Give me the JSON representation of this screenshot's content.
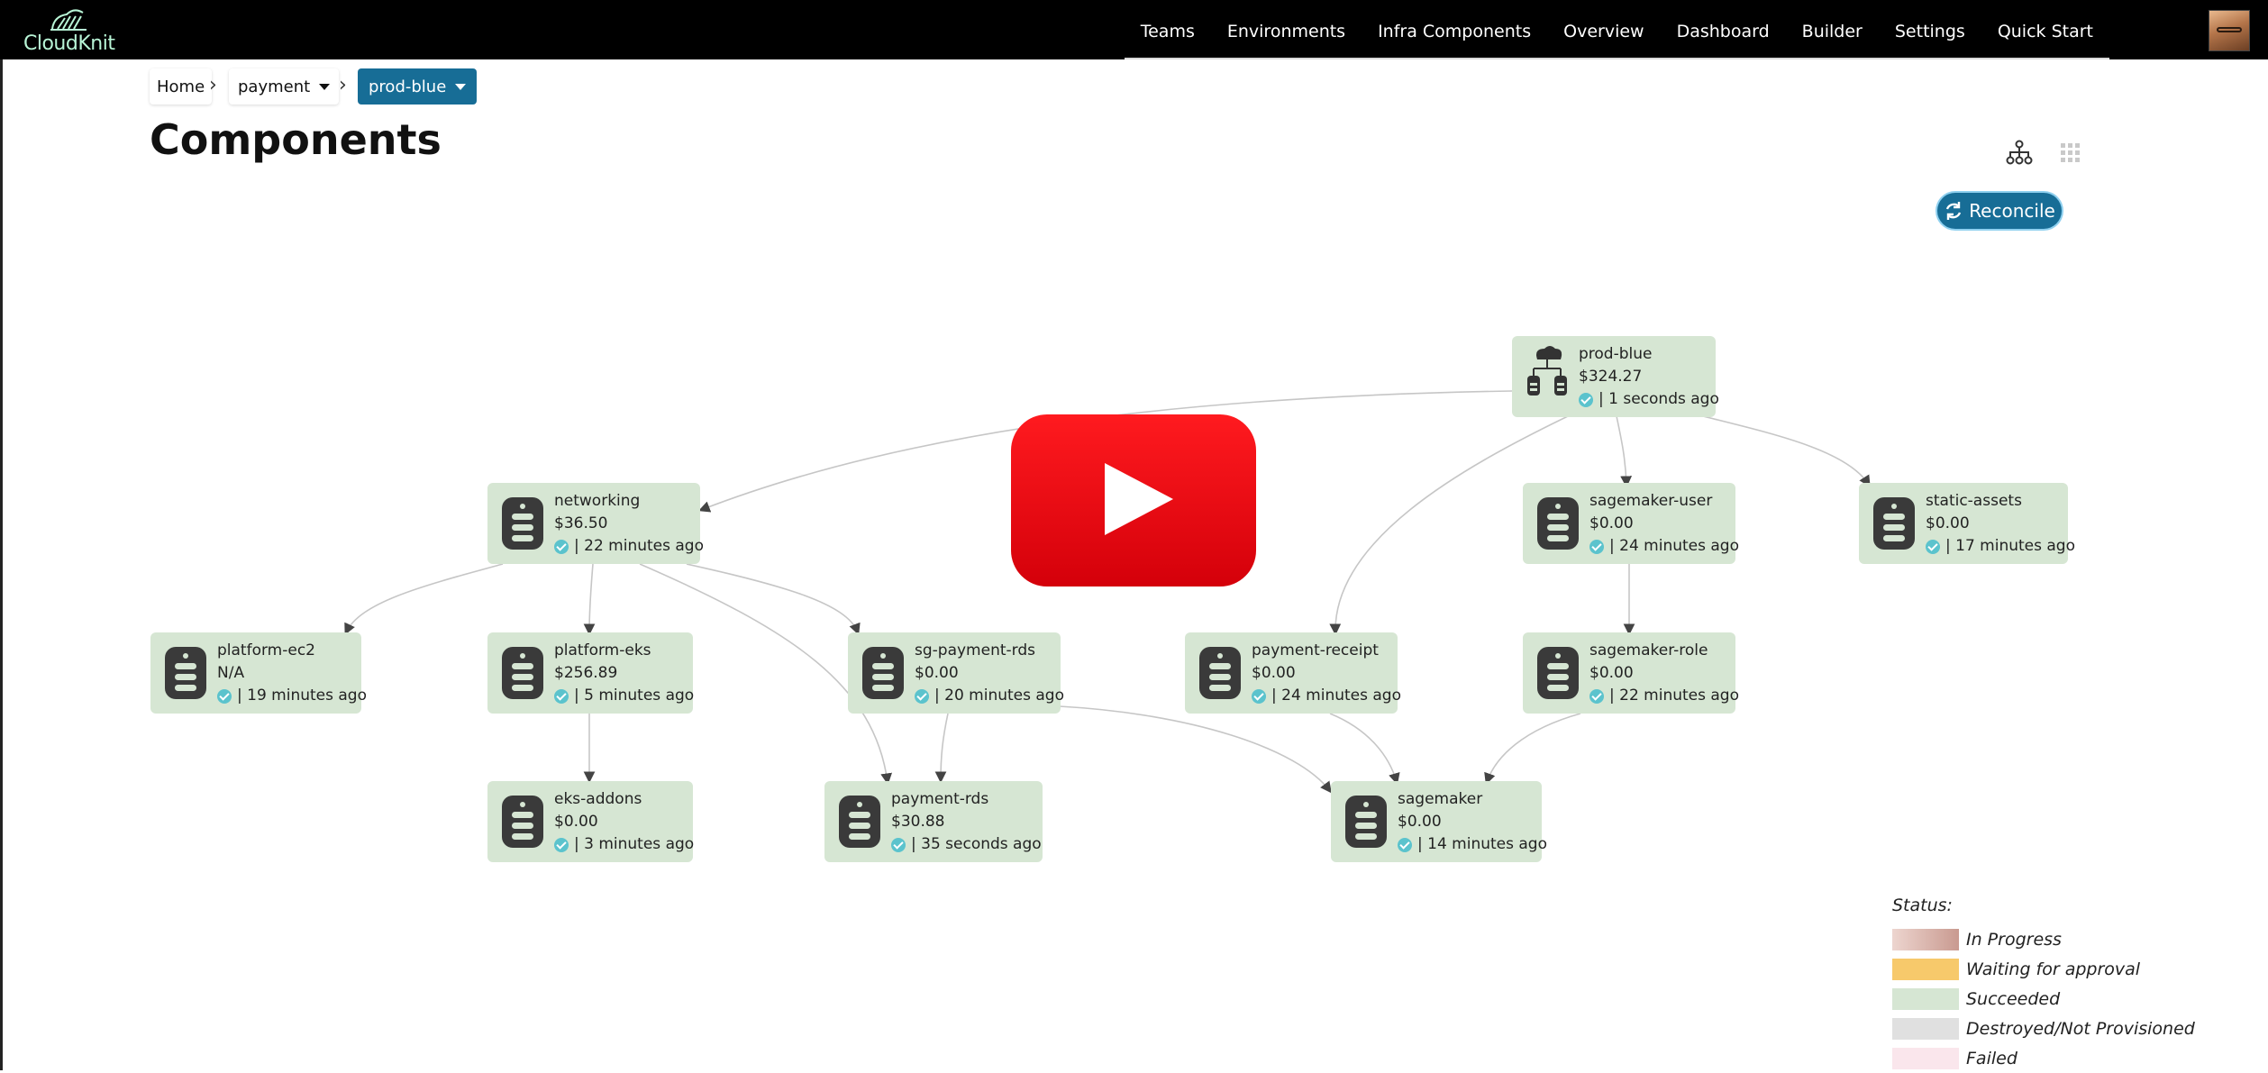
{
  "app": {
    "logo_text": "CloudKnit"
  },
  "nav": {
    "items": [
      "Teams",
      "Environments",
      "Infra Components",
      "Overview",
      "Dashboard",
      "Builder",
      "Settings",
      "Quick Start"
    ]
  },
  "breadcrumb": {
    "home": "Home",
    "team": "payment",
    "environment": "prod-blue"
  },
  "page": {
    "title": "Components",
    "reconcile_label": "Reconcile"
  },
  "nodes": [
    {
      "id": "prod-blue",
      "name": "prod-blue",
      "cost": "$324.27",
      "status": "| 1 seconds ago",
      "icon": "cloud-network-icon"
    },
    {
      "id": "networking",
      "name": "networking",
      "cost": "$36.50",
      "status": "| 22 minutes ago",
      "icon": "server-icon"
    },
    {
      "id": "sagemaker-user",
      "name": "sagemaker-user",
      "cost": "$0.00",
      "status": "| 24 minutes ago",
      "icon": "server-icon"
    },
    {
      "id": "static-assets",
      "name": "static-assets",
      "cost": "$0.00",
      "status": "| 17 minutes ago",
      "icon": "server-icon"
    },
    {
      "id": "platform-ec2",
      "name": "platform-ec2",
      "cost": "N/A",
      "status": "| 19 minutes ago",
      "icon": "server-icon"
    },
    {
      "id": "platform-eks",
      "name": "platform-eks",
      "cost": "$256.89",
      "status": "| 5 minutes ago",
      "icon": "server-icon"
    },
    {
      "id": "sg-payment-rds",
      "name": "sg-payment-rds",
      "cost": "$0.00",
      "status": "| 20 minutes ago",
      "icon": "server-icon"
    },
    {
      "id": "payment-receipt",
      "name": "payment-receipt",
      "cost": "$0.00",
      "status": "| 24 minutes ago",
      "icon": "server-icon"
    },
    {
      "id": "sagemaker-role",
      "name": "sagemaker-role",
      "cost": "$0.00",
      "status": "| 22 minutes ago",
      "icon": "server-icon"
    },
    {
      "id": "eks-addons",
      "name": "eks-addons",
      "cost": "$0.00",
      "status": "| 3 minutes ago",
      "icon": "server-icon"
    },
    {
      "id": "payment-rds",
      "name": "payment-rds",
      "cost": "$30.88",
      "status": "| 35 seconds ago",
      "icon": "server-icon"
    },
    {
      "id": "sagemaker",
      "name": "sagemaker",
      "cost": "$0.00",
      "status": "| 14 minutes ago",
      "icon": "server-icon"
    }
  ],
  "legend": {
    "title": "Status:",
    "items": [
      {
        "label": "In Progress",
        "color": "#e2c3bd"
      },
      {
        "label": "Waiting for approval",
        "color": "#f7c96b"
      },
      {
        "label": "Succeeded",
        "color": "#d6e6d3"
      },
      {
        "label": "Destroyed/Not Provisioned",
        "color": "#e0e0e0"
      },
      {
        "label": "Failed",
        "color": "#fae6ec"
      }
    ]
  },
  "colors": {
    "accent": "#176d96",
    "node_succeeded": "#d6e6d3",
    "status_check": "#5bc3cd",
    "play_red": "#e60a13"
  }
}
